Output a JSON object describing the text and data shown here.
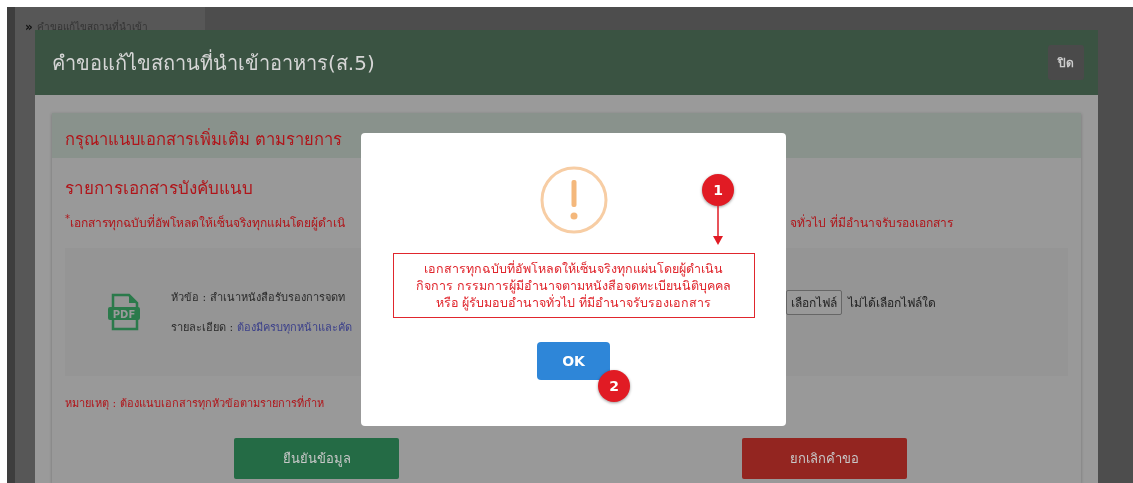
{
  "sidebar": {
    "items": [
      {
        "marker": "»",
        "label": "คำขอแก้ไขสถานที่นำเข้า"
      }
    ]
  },
  "dialog": {
    "title": "คำขอแก้ไขสถานที่นำเข้าอาหาร(ส.5)",
    "close_button": "ปิด",
    "card": {
      "heading": "กรุณาแนบเอกสารเพิ่มเติม ตามรายการ",
      "section_title": "รายการเอกสารบังคับแนบ",
      "notice": {
        "mark": "*",
        "left": "เอกสารทุกฉบับที่อัพโหลดให้เซ็นจริงทุกแผ่นโดยผู้ดำเนิ",
        "right": "จทั่วไป ที่มีอำนาจรับรองเอกสาร"
      },
      "document": {
        "icon_label": "PDF",
        "subject_label": "หัวข้อ : ",
        "subject": "สำเนาหนังสือรับรองการจดท",
        "detail_label": "รายละเอียด : ",
        "detail": "ต้องมีครบทุกหน้าและคัด",
        "file_button": "เลือกไฟล์",
        "file_status": "ไม่ได้เลือกไฟล์ใด"
      },
      "remark": "หมายเหตุ : ต้องแนบเอกสารทุกหัวข้อตามรายการที่กำห",
      "buttons": [
        {
          "label": "ยืนยันข้อมูล",
          "kind": "confirm"
        },
        {
          "label": "ยกเลิกคำขอ",
          "kind": "cancel"
        }
      ]
    }
  },
  "alert": {
    "message": "เอกสารทุกฉบับที่อัพโหลดให้เซ็นจริงทุกแผ่นโดยผู้ดำเนินกิจการ กรรมการผู้มีอำนาจตามหนังสือจดทะเบียนนิติบุคคล หรือ ผู้รับมอบอำนาจทั่วไป ที่มีอำนาจรับรองเอกสาร",
    "ok_button": "OK"
  },
  "annotations": [
    {
      "label": "1"
    },
    {
      "label": "2"
    }
  ]
}
